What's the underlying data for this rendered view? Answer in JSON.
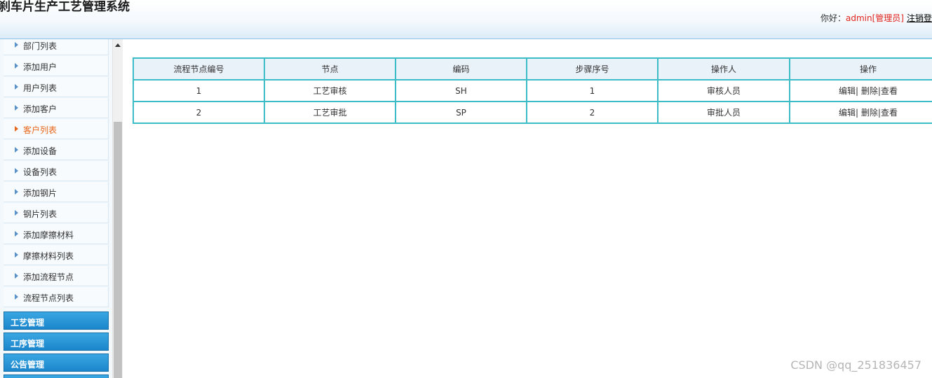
{
  "header": {
    "title": "刹车片生产工艺管理系统",
    "greeting": "你好：",
    "username": "admin[管理员]",
    "logout_label": "注销登"
  },
  "sidebar": {
    "items": [
      {
        "label": "部门列表",
        "active": false
      },
      {
        "label": "添加用户",
        "active": false
      },
      {
        "label": "用户列表",
        "active": false
      },
      {
        "label": "添加客户",
        "active": false
      },
      {
        "label": "客户列表",
        "active": true
      },
      {
        "label": "添加设备",
        "active": false
      },
      {
        "label": "设备列表",
        "active": false
      },
      {
        "label": "添加钢片",
        "active": false
      },
      {
        "label": "钢片列表",
        "active": false
      },
      {
        "label": "添加摩擦材料",
        "active": false
      },
      {
        "label": "摩擦材料列表",
        "active": false
      },
      {
        "label": "添加流程节点",
        "active": false
      },
      {
        "label": "流程节点列表",
        "active": false
      }
    ],
    "groups": [
      {
        "label": "工艺管理"
      },
      {
        "label": "工序管理"
      },
      {
        "label": "公告管理"
      }
    ]
  },
  "table": {
    "columns": [
      "流程节点编号",
      "节点",
      "编码",
      "步骤序号",
      "操作人",
      "操作"
    ],
    "rows": [
      {
        "id": "1",
        "node": "工艺审核",
        "code": "SH",
        "step": "1",
        "operator": "审核人员"
      },
      {
        "id": "2",
        "node": "工艺审批",
        "code": "SP",
        "step": "2",
        "operator": "审批人员"
      }
    ],
    "actions": {
      "edit": "编辑|",
      "delete": " 删除|",
      "view": "查看"
    }
  },
  "watermark": "CSDN @qq_251836457"
}
